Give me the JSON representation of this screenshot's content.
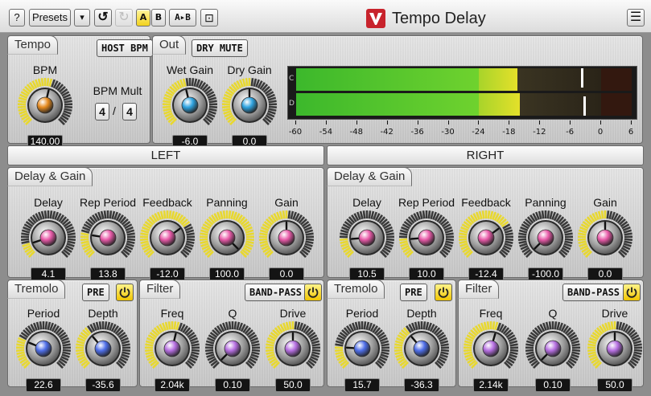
{
  "toolbar": {
    "help": "?",
    "presets": "Presets",
    "dropdown": "▾",
    "undo": "↺",
    "redo": "↻",
    "a": "A",
    "b": "B",
    "a_to_b": "A▸B",
    "compare": "⊡",
    "menu": "☰"
  },
  "title": "Tempo Delay",
  "tempo": {
    "tab": "Tempo",
    "host_bpm": "HOST BPM",
    "bpm_label": "BPM",
    "bpm_value": "140.00",
    "bpm_fraction": 0.55,
    "bpm_mult_label": "BPM Mult",
    "mult_num": "4",
    "mult_sep": "/",
    "mult_den": "4"
  },
  "out": {
    "tab": "Out",
    "dry_mute": "DRY MUTE",
    "wet_label": "Wet Gain",
    "wet_value": "-6.0",
    "wet_fraction": 0.45,
    "dry_label": "Dry Gain",
    "dry_value": "0.0",
    "dry_fraction": 0.5
  },
  "meter": {
    "channels": [
      "C",
      "D"
    ],
    "scale": [
      "-60",
      "-54",
      "-48",
      "-42",
      "-36",
      "-30",
      "-24",
      "-18",
      "-12",
      "-6",
      "0",
      "6"
    ],
    "level_db": [
      -16.5,
      -16.0
    ],
    "peak_db": [
      -4.0,
      -3.5
    ],
    "colors": {
      "low": "#3cb82c",
      "high": "#e4e02a",
      "bg": "#2a1d16",
      "hold": "#ffffff"
    }
  },
  "left": {
    "header": "LEFT",
    "delay_gain_tab": "Delay & Gain",
    "knobs": [
      {
        "label": "Delay",
        "value": "4.1",
        "fraction": 0.1,
        "color": "#e85aa8"
      },
      {
        "label": "Rep Period",
        "value": "13.8",
        "fraction": 0.2,
        "color": "#e85aa8"
      },
      {
        "label": "Feedback",
        "value": "-12.0",
        "fraction": 0.7,
        "color": "#e85aa8"
      },
      {
        "label": "Panning",
        "value": "100.0",
        "fraction": 1.0,
        "color": "#e85aa8"
      },
      {
        "label": "Gain",
        "value": "0.0",
        "fraction": 0.5,
        "color": "#e85aa8"
      }
    ],
    "tremolo": {
      "tab": "Tremolo",
      "pre": "PRE",
      "knobs": [
        {
          "label": "Period",
          "value": "22.6",
          "fraction": 0.25,
          "color": "#4e6ee8"
        },
        {
          "label": "Depth",
          "value": "-35.6",
          "fraction": 0.35,
          "color": "#4e6ee8"
        }
      ]
    },
    "filter": {
      "tab": "Filter",
      "mode": "BAND-PASS",
      "knobs": [
        {
          "label": "Freq",
          "value": "2.04k",
          "fraction": 0.55,
          "color": "#b56ee0"
        },
        {
          "label": "Q",
          "value": "0.10",
          "fraction": 0.0,
          "color": "#b56ee0"
        },
        {
          "label": "Drive",
          "value": "50.0",
          "fraction": 0.5,
          "color": "#b56ee0"
        }
      ]
    }
  },
  "right": {
    "header": "RIGHT",
    "delay_gain_tab": "Delay & Gain",
    "knobs": [
      {
        "label": "Delay",
        "value": "10.5",
        "fraction": 0.15,
        "color": "#e85aa8"
      },
      {
        "label": "Rep Period",
        "value": "10.0",
        "fraction": 0.15,
        "color": "#e85aa8"
      },
      {
        "label": "Feedback",
        "value": "-12.4",
        "fraction": 0.7,
        "color": "#e85aa8"
      },
      {
        "label": "Panning",
        "value": "-100.0",
        "fraction": 0.0,
        "color": "#e85aa8"
      },
      {
        "label": "Gain",
        "value": "0.0",
        "fraction": 0.5,
        "color": "#e85aa8"
      }
    ],
    "tremolo": {
      "tab": "Tremolo",
      "pre": "PRE",
      "knobs": [
        {
          "label": "Period",
          "value": "15.7",
          "fraction": 0.18,
          "color": "#4e6ee8"
        },
        {
          "label": "Depth",
          "value": "-36.3",
          "fraction": 0.35,
          "color": "#4e6ee8"
        }
      ]
    },
    "filter": {
      "tab": "Filter",
      "mode": "BAND-PASS",
      "knobs": [
        {
          "label": "Freq",
          "value": "2.14k",
          "fraction": 0.56,
          "color": "#b56ee0"
        },
        {
          "label": "Q",
          "value": "0.10",
          "fraction": 0.0,
          "color": "#b56ee0"
        },
        {
          "label": "Drive",
          "value": "50.0",
          "fraction": 0.5,
          "color": "#b56ee0"
        }
      ]
    }
  }
}
